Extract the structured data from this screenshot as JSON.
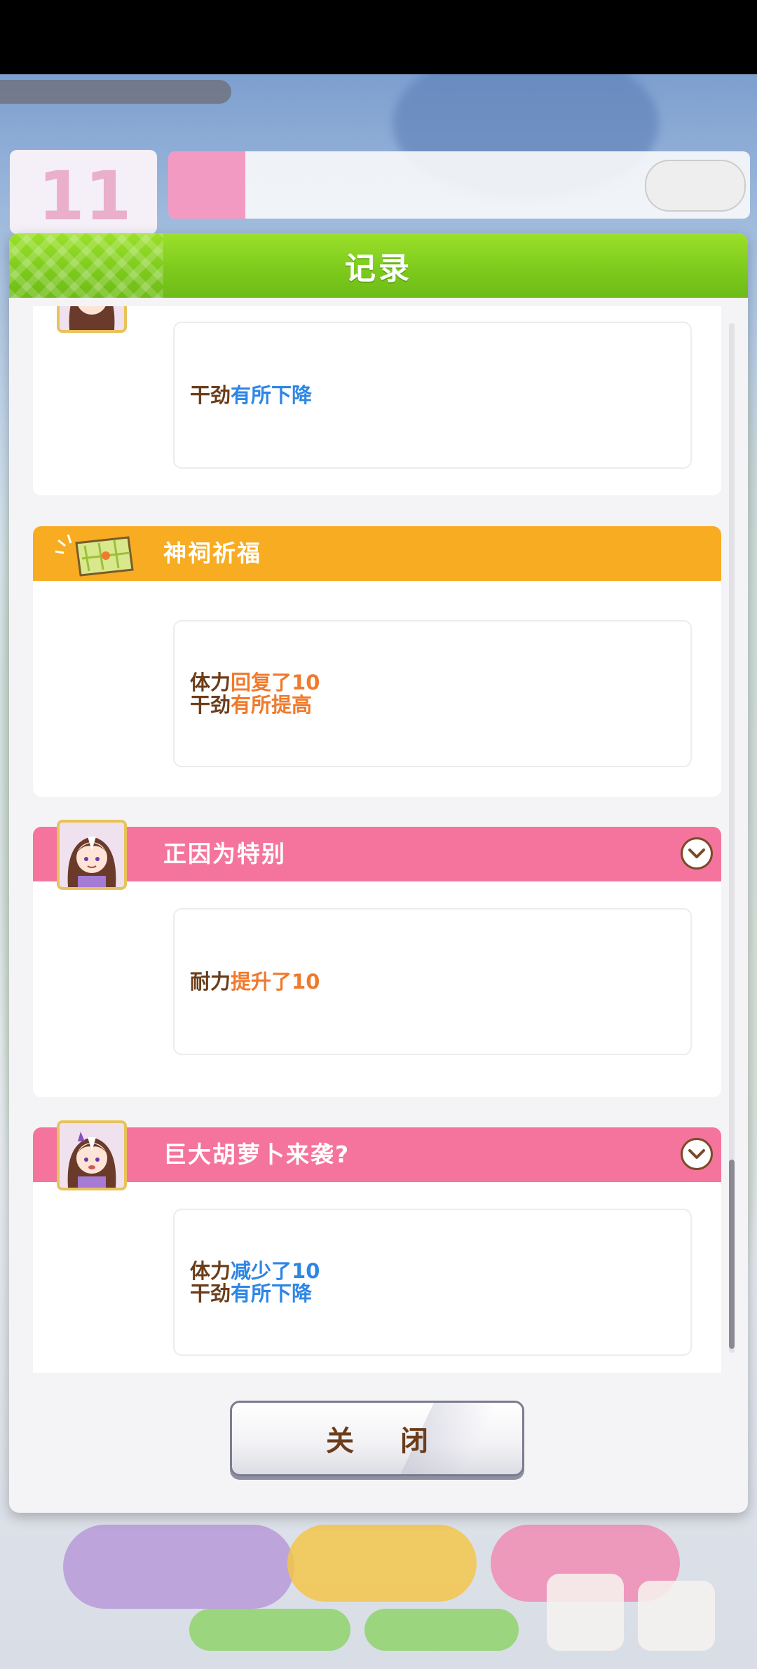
{
  "header_bg": {
    "turn_number": "11"
  },
  "dialog": {
    "title": "记录",
    "close_label": "关 闭"
  },
  "entries": [
    {
      "title": "",
      "bar_color": "#f5749d",
      "lines": [
        {
          "label": "干劲",
          "change": "有所下降",
          "direction": "down"
        }
      ]
    },
    {
      "title": "神祠祈福",
      "bar_color": "#f7ac22",
      "icon": "map-scroll-icon",
      "lines": [
        {
          "label": "体力",
          "change": "回复了10",
          "direction": "up"
        },
        {
          "label": "干劲",
          "change": "有所提高",
          "direction": "up"
        }
      ]
    },
    {
      "title": "正因为特别",
      "bar_color": "#f5749d",
      "icon": "character-portrait",
      "lines": [
        {
          "label": "耐力",
          "change": "提升了10",
          "direction": "up"
        }
      ]
    },
    {
      "title": "巨大胡萝卜来袭?",
      "bar_color": "#f5749d",
      "icon": "character-portrait",
      "lines": [
        {
          "label": "体力",
          "change": "减少了10",
          "direction": "down"
        },
        {
          "label": "干劲",
          "change": "有所下降",
          "direction": "down"
        }
      ]
    }
  ],
  "colors": {
    "header_green": "#7ecb1d",
    "label_brown": "#6b3d1a",
    "decrease_blue": "#2d86e6",
    "increase_orange": "#f07a2c"
  }
}
